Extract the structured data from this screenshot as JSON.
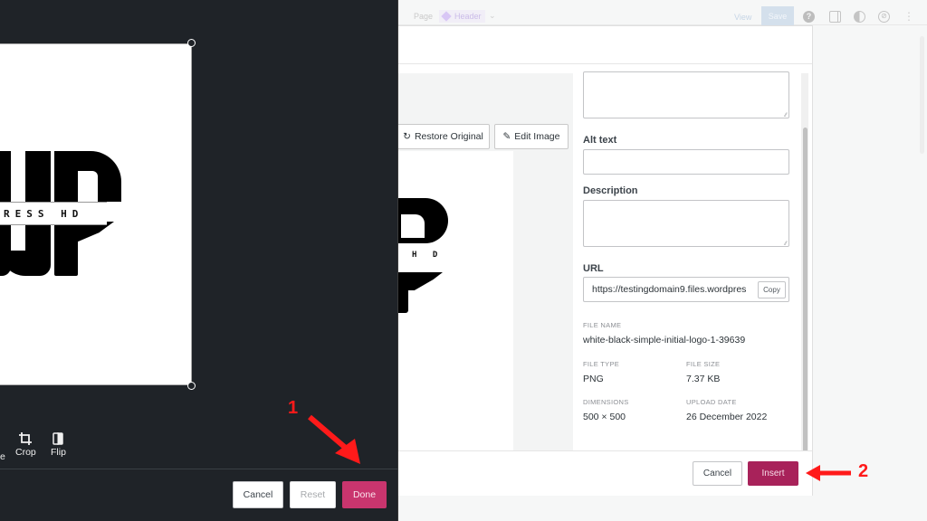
{
  "topbar": {
    "page_label": "Page",
    "template_label": "Header",
    "view_label": "View",
    "save_label": "Save",
    "icons": [
      "help-icon",
      "sidebar-toggle-icon",
      "contrast-icon",
      "compass-icon",
      "more-options-icon"
    ]
  },
  "image_editor": {
    "logo_band_text": "RESS  HD",
    "tools": [
      {
        "label": "Crop",
        "icon": "crop-icon"
      },
      {
        "label": "Flip",
        "icon": "flip-icon"
      }
    ],
    "prev_tool_label_fragment": "e",
    "buttons": {
      "cancel": "Cancel",
      "reset": "Reset",
      "done": "Done"
    },
    "colors": {
      "done": "#c9356e",
      "background": "#1f2328"
    }
  },
  "media_modal": {
    "restore_label": "Restore Original",
    "edit_label": "Edit Image",
    "preview_band_text": "H D",
    "fields": {
      "caption_value": "",
      "alt_text_label": "Alt text",
      "alt_text_value": "",
      "description_label": "Description",
      "description_value": "",
      "url_label": "URL",
      "url_value": "https://testingdomain9.files.wordpres",
      "copy_label": "Copy"
    },
    "meta": {
      "file_name_label": "FILE NAME",
      "file_name_value": "white-black-simple-initial-logo-1-39639",
      "file_type_label": "FILE TYPE",
      "file_type_value": "PNG",
      "file_size_label": "FILE SIZE",
      "file_size_value": "7.37 KB",
      "dimensions_label": "DIMENSIONS",
      "dimensions_value": "500 × 500",
      "upload_date_label": "UPLOAD DATE",
      "upload_date_value": "26 December 2022"
    },
    "footer": {
      "cancel_label": "Cancel",
      "insert_label": "Insert"
    },
    "colors": {
      "insert": "#a8225a"
    }
  },
  "annotations": {
    "step1": "1",
    "step2": "2",
    "color": "#ff1a1a"
  }
}
